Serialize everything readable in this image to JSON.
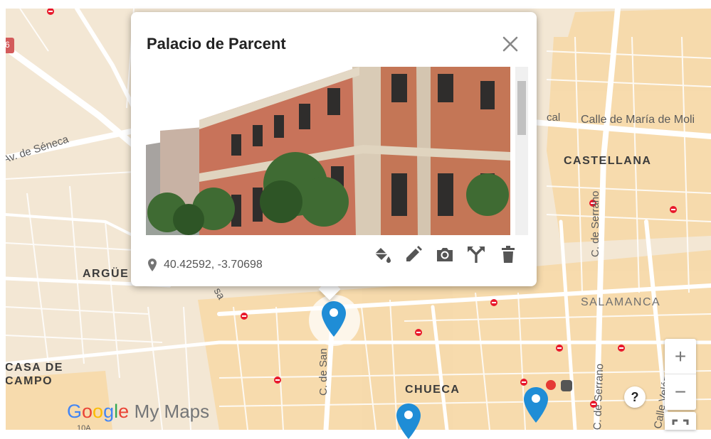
{
  "popup": {
    "title": "Palacio de Parcent",
    "coordinates": "40.42592, -3.70698",
    "close_icon": "close-icon",
    "tools": [
      "paint-bucket-icon",
      "edit-pencil-icon",
      "camera-icon",
      "directions-icon",
      "delete-icon"
    ]
  },
  "map": {
    "labels": {
      "castellana": "CASTELLANA",
      "salamanca": "SALAMANCA",
      "chueca": "CHUECA",
      "casa_de": "CASA DE",
      "campo": "CAMPO",
      "arguelles": "ARGÜE",
      "seneca": "Av. de Séneca",
      "maria_molina": "Calle de María de Moli",
      "cal": "cal",
      "serrano_top": "C. de Serrano",
      "serrano_bottom": "C. de Serrano",
      "velazquez": "Calle Velázquez",
      "san_street": "C. de San",
      "sa": "sa",
      "route_shield": "6",
      "road_number": "10A"
    },
    "colors": {
      "land": "#f3e7d4",
      "urban": "#f7d9a8",
      "street": "#ffffff",
      "park": "#e9ddc6",
      "marker": "#1f8dd6"
    }
  },
  "controls": {
    "zoom_in": "+",
    "zoom_out": "−",
    "help": "?"
  },
  "branding": {
    "google": [
      "G",
      "o",
      "o",
      "g",
      "l",
      "e"
    ],
    "product": "My Maps"
  }
}
